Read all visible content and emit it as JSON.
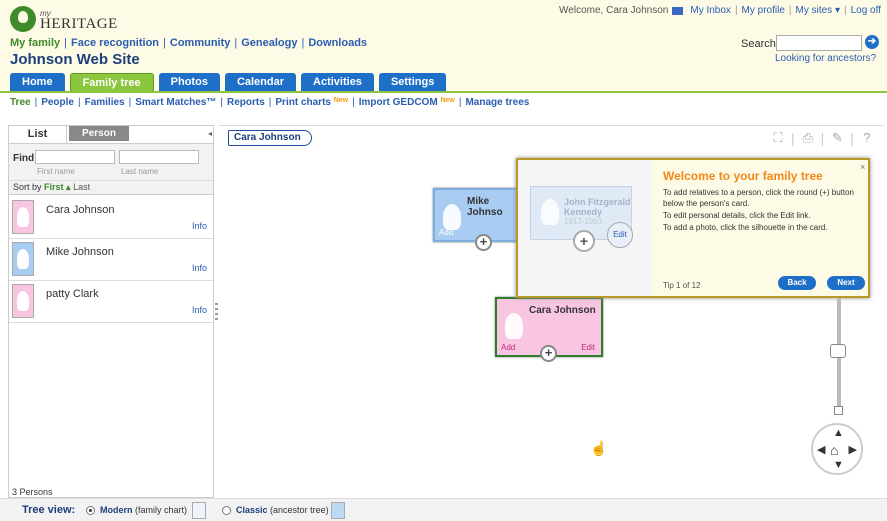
{
  "header": {
    "logo_my": "my",
    "logo_heritage": "HERITAGE",
    "welcome": "Welcome, Cara Johnson",
    "inbox": "My Inbox",
    "profile": "My profile",
    "sites": "My sites ▾",
    "logoff": "Log off",
    "search_label": "Search",
    "search_value": "",
    "search_go": "➔",
    "looking": "Looking for ancestors?",
    "site_title": "Johnson Web Site"
  },
  "main_nav": [
    "My family",
    "Face recognition",
    "Community",
    "Genealogy",
    "Downloads"
  ],
  "tabs": [
    "Home",
    "Family tree",
    "Photos",
    "Calendar",
    "Activities",
    "Settings"
  ],
  "sub_nav": {
    "tree": "Tree",
    "people": "People",
    "families": "Families",
    "smart_matches": "Smart Matches™",
    "reports": "Reports",
    "print_charts": "Print charts",
    "new_1": "New",
    "import_gedcom": "Import GEDCOM",
    "new_2": "New",
    "manage_trees": "Manage trees"
  },
  "left_panel": {
    "tab_list": "List",
    "tab_person": "Person",
    "find": "Find",
    "first_name_placeholder": "First name",
    "last_name_placeholder": "Last name",
    "sort_by": "Sort by",
    "sort_first": "First ▴",
    "sort_last": "Last",
    "people": [
      {
        "name": "Cara Johnson",
        "info": "Info",
        "gender": "female"
      },
      {
        "name": "Mike Johnson",
        "info": "Info",
        "gender": "male"
      },
      {
        "name": "patty Clark",
        "info": "Info",
        "gender": "female"
      }
    ],
    "count": "3 Persons"
  },
  "canvas": {
    "breadcrumb": "Cara Johnson",
    "toolbar_icons": [
      "fullscreen-icon",
      "print-icon",
      "wrench-icon",
      "help-icon"
    ]
  },
  "cards": {
    "mike": {
      "name": "Mike Johnso",
      "add": "Add"
    },
    "cara": {
      "name": "Cara Johnson",
      "add": "Add",
      "edit": "Edit"
    }
  },
  "popup": {
    "card_name": "John Fitzgerald Kennedy",
    "card_date": "1917-1963",
    "edit": "Edit",
    "title": "Welcome to your family tree",
    "line1": "To add relatives to a person, click the round (+) button below the person's card.",
    "line2": "To edit personal details, click the Edit link.",
    "line3": "To add a photo, click the silhouette in the card.",
    "step": "Tip 1 of 12",
    "back": "Back",
    "next": "Next",
    "close": "×"
  },
  "bottom": {
    "tree_view": "Tree view:",
    "modern_label": "Modern",
    "modern_sub": "(family chart)",
    "classic_label": "Classic",
    "classic_sub": "(ancestor tree)"
  },
  "colors": {
    "accent_blue": "#1e6fc8",
    "accent_green": "#8cc63f",
    "header_bg": "#fdfbe6",
    "popup_title": "#f08a1c"
  }
}
